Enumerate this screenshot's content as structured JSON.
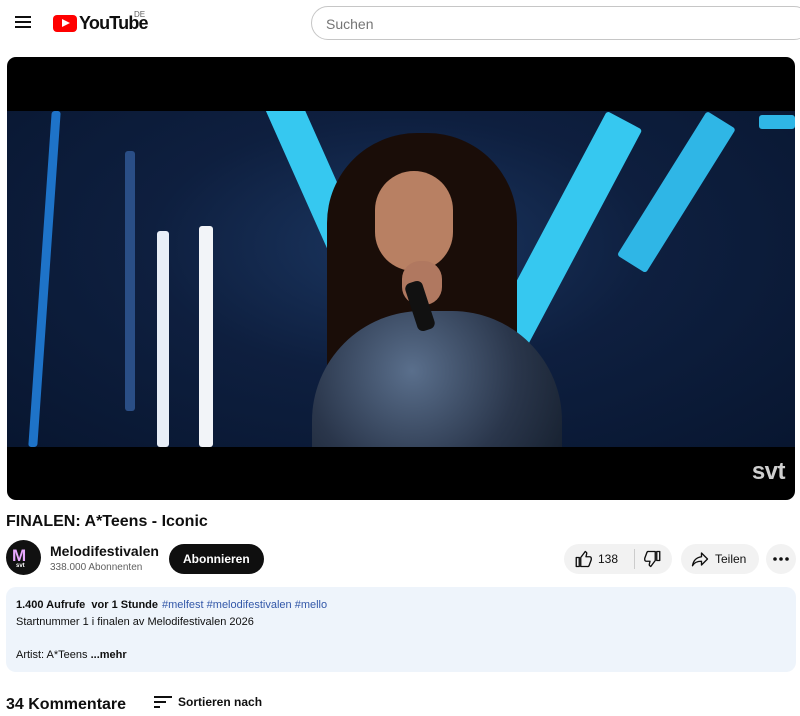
{
  "header": {
    "logo_text": "YouTube",
    "region": "DE",
    "search_placeholder": "Suchen"
  },
  "video": {
    "watermark": "svt",
    "title": "FINALEN: A*Teens - Iconic"
  },
  "channel": {
    "name": "Melodifestivalen",
    "subscribers": "338.000 Abonnenten",
    "avatar_text": "svt",
    "subscribe_label": "Abonnieren"
  },
  "actions": {
    "like_count": "138",
    "share_label": "Teilen"
  },
  "description": {
    "stats": "1.400 Aufrufe  vor 1 Stunde",
    "hashtags": "#melfest #melodifestivalen #mello",
    "line2": "Startnummer 1 i finalen av Melodifestivalen 2026",
    "line3_visible": "Artist: A*Teens",
    "more_label": "...mehr"
  },
  "comments": {
    "count_label": "34 Kommentare",
    "sort_label": "Sortieren nach"
  },
  "colors": {
    "brand_red": "#ff0000",
    "link_blue": "#3257a8",
    "description_bg": "#eef4fb",
    "stage_beam": "#36c8f0"
  }
}
